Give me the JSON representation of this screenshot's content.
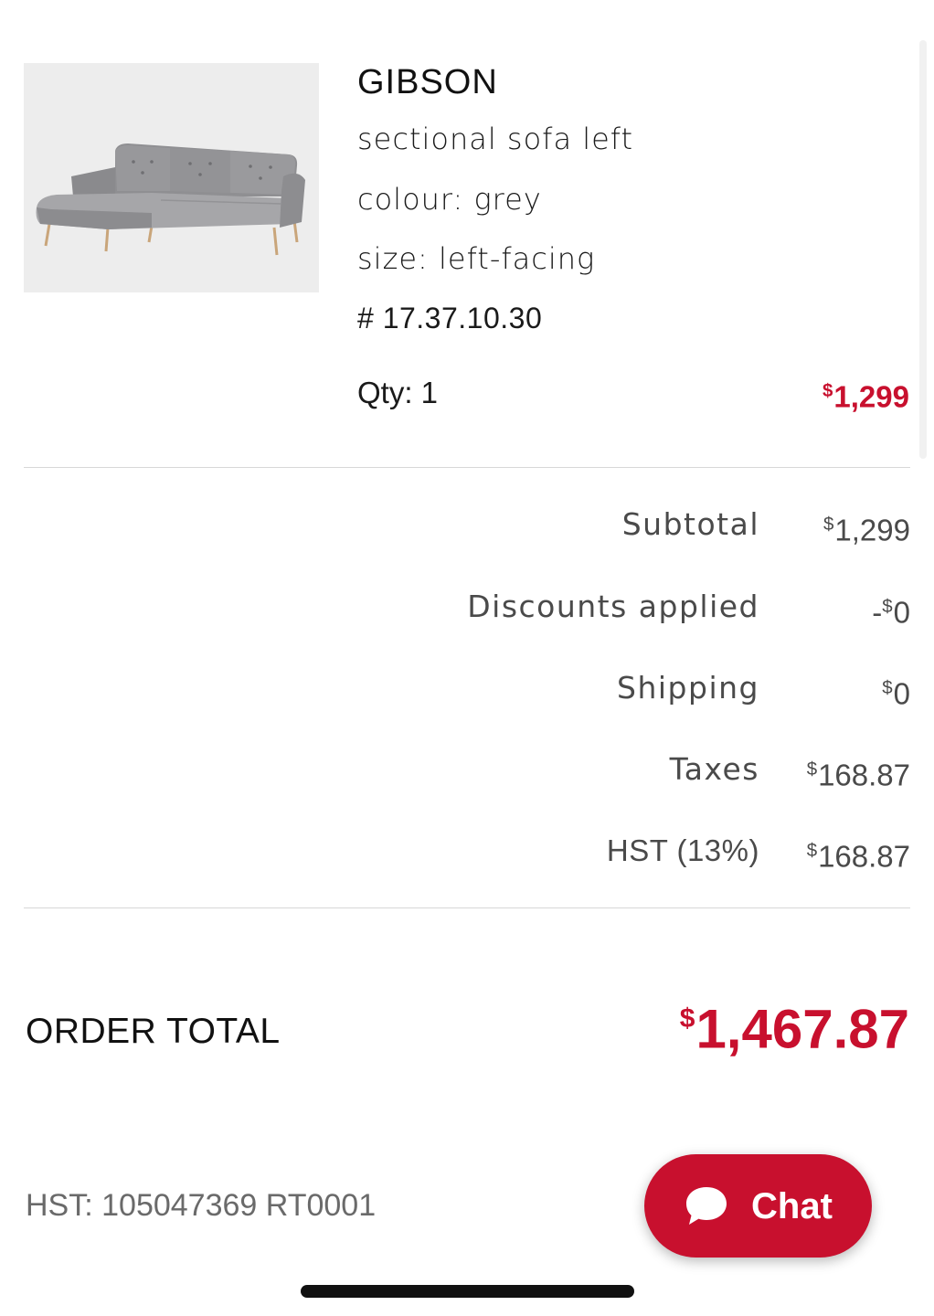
{
  "product": {
    "name": "GIBSON",
    "description": "sectional sofa left",
    "colour": "colour: grey",
    "size": "size: left-facing",
    "sku": "# 17.37.10.30",
    "qty": "Qty: 1",
    "price_symbol": "$",
    "price_amount": "1,299",
    "image_icon": "sectional-sofa-image"
  },
  "summary": {
    "subtotal": {
      "label": "Subtotal",
      "symbol": "$",
      "amount": "1,299"
    },
    "discounts": {
      "label": "Discounts applied",
      "prefix": "-",
      "symbol": "$",
      "amount": "0"
    },
    "shipping": {
      "label": "Shipping",
      "symbol": "$",
      "amount": "0"
    },
    "taxes": {
      "label": "Taxes",
      "symbol": "$",
      "amount": "168.87"
    },
    "hst": {
      "label": "HST (13%)",
      "symbol": "$",
      "amount": "168.87"
    }
  },
  "order_total": {
    "label": "ORDER TOTAL",
    "symbol": "$",
    "amount": "1,467.87"
  },
  "hst_registration": "HST: 105047369 RT0001",
  "chat": {
    "label": "Chat",
    "icon": "speech-bubble-icon"
  },
  "colors": {
    "accent_red": "#c8102e",
    "text_gray": "#4a4a4a",
    "divider": "#d8d8d8"
  }
}
